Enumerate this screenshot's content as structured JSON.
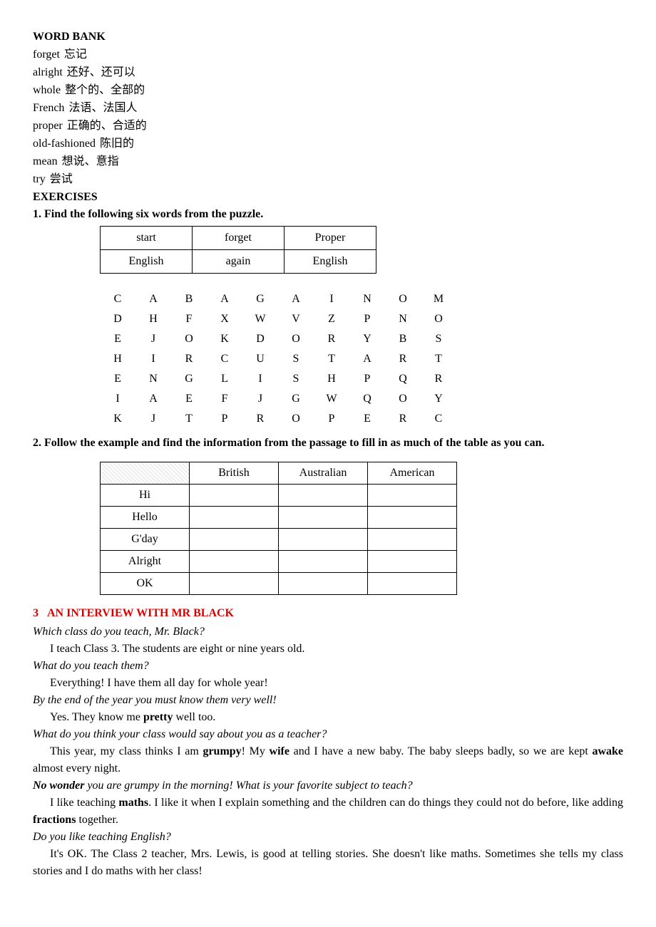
{
  "word_bank": {
    "heading": "WORD BANK",
    "entries": [
      {
        "word": "forget",
        "def": "忘记"
      },
      {
        "word": "alright",
        "def": "还好、还可以"
      },
      {
        "word": "whole",
        "def": "整个的、全部的"
      },
      {
        "word": "French",
        "def": "法语、法国人"
      },
      {
        "word": "proper",
        "def": "正确的、合适的"
      },
      {
        "word": "old-fashioned",
        "def": "陈旧的"
      },
      {
        "word": "mean",
        "def": "想说、意指"
      },
      {
        "word": "try",
        "def": "尝试"
      }
    ]
  },
  "exercises_heading": "EXERCISES",
  "ex1": {
    "prompt": "1. Find the following six words from the puzzle.",
    "words_box": [
      [
        "start",
        "forget",
        "Proper"
      ],
      [
        "English",
        "again",
        "English"
      ]
    ],
    "puzzle": [
      [
        "C",
        "A",
        "B",
        "A",
        "G",
        "A",
        "I",
        "N",
        "O",
        "M"
      ],
      [
        "D",
        "H",
        "F",
        "X",
        "W",
        "V",
        "Z",
        "P",
        "N",
        "O"
      ],
      [
        "E",
        "J",
        "O",
        "K",
        "D",
        "O",
        "R",
        "Y",
        "B",
        "S"
      ],
      [
        "H",
        "I",
        "R",
        "C",
        "U",
        "S",
        "T",
        "A",
        "R",
        "T"
      ],
      [
        "E",
        "N",
        "G",
        "L",
        "I",
        "S",
        "H",
        "P",
        "Q",
        "R"
      ],
      [
        "I",
        "A",
        "E",
        "F",
        "J",
        "G",
        "W",
        "Q",
        "O",
        "Y"
      ],
      [
        "K",
        "J",
        "T",
        "P",
        "R",
        "O",
        "P",
        "E",
        "R",
        "C"
      ]
    ]
  },
  "ex2": {
    "prompt": "2. Follow the example and find the information from the passage to fill in as much of the table as you can.",
    "headers": [
      "",
      "British",
      "Australian",
      "American"
    ],
    "rows": [
      "Hi",
      "Hello",
      "G'day",
      "Alright",
      "OK"
    ]
  },
  "ex3": {
    "heading_num": "3",
    "heading_text": "AN INTERVIEW WITH MR BLACK",
    "qa": [
      {
        "q": "Which class do you teach, Mr. Black?",
        "a_parts": [
          {
            "t": "I teach Class 3. The students are eight or nine years old."
          }
        ]
      },
      {
        "q": "What do you teach them?",
        "a_parts": [
          {
            "t": "Everything! I have them all day for whole year!"
          }
        ]
      },
      {
        "q": "By the end of the year you must know them very well!",
        "a_parts": [
          {
            "t": "Yes. They know me "
          },
          {
            "t": "pretty",
            "b": true
          },
          {
            "t": " well too."
          }
        ]
      },
      {
        "q": "What do you think your class would say about you as a teacher?",
        "a_parts": [
          {
            "t": "This year, my class thinks I am "
          },
          {
            "t": "grumpy",
            "b": true
          },
          {
            "t": "! My "
          },
          {
            "t": "wife",
            "b": true
          },
          {
            "t": " and I have a new baby. The baby sleeps badly, so we are kept "
          },
          {
            "t": "awake",
            "b": true
          },
          {
            "t": " almost every night."
          }
        ]
      },
      {
        "q_parts": [
          {
            "t": "No wonder",
            "b": true
          },
          {
            "t": " you are grumpy in the morning! What is your favorite subject to teach?"
          }
        ],
        "a_parts": [
          {
            "t": "I like teaching "
          },
          {
            "t": "maths",
            "b": true
          },
          {
            "t": ". I like it when I explain something and the children can do things they could not do before, like adding "
          },
          {
            "t": "fractions",
            "b": true
          },
          {
            "t": " together."
          }
        ]
      },
      {
        "q": "Do you like teaching English?",
        "a_parts": [
          {
            "t": "It's OK. The Class 2 teacher, Mrs. Lewis, is good at telling stories. She doesn't like maths. Sometimes she tells my class stories and I do maths with her class!"
          }
        ]
      }
    ]
  }
}
